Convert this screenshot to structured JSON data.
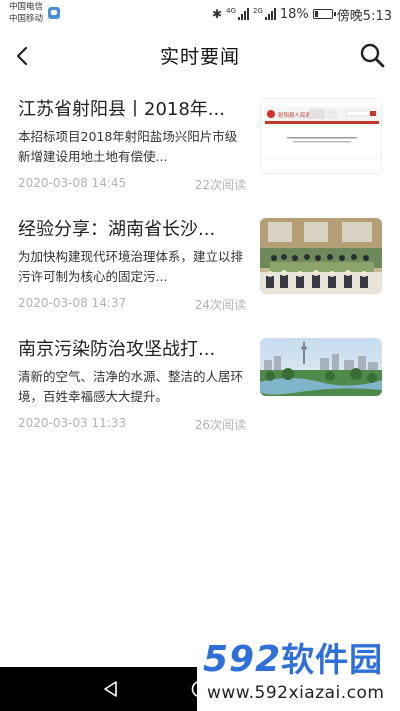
{
  "status_bar": {
    "carrier_1": "中国电信",
    "carrier_2": "中国移动",
    "net_1": "4G",
    "net_2": "2G",
    "battery_level": 0.18,
    "battery": "18%",
    "time": "傍晚5:13"
  },
  "header": {
    "title": "实时要闻"
  },
  "news": [
    {
      "title": "江苏省射阳县丨2018年...",
      "desc": "本招标项目2018年射阳盐场兴阳片市级新增建设用地土地有偿使...",
      "date": "2020-03-08 14:45",
      "reads": "22次阅读",
      "thumb_icon": "webpage-screenshot-thumbnail",
      "thumb_text": "射阳县人民政府"
    },
    {
      "title": "经验分享：湖南省长沙...",
      "desc": "为加快构建现代环境治理体系，建立以排污许可制为核心的固定污...",
      "date": "2020-03-08 14:37",
      "reads": "24次阅读",
      "thumb_icon": "conference-room-photo"
    },
    {
      "title": "南京污染防治攻坚战打...",
      "desc": "清新的空气、洁净的水源、整洁的人居环境，百姓幸福感大大提升。",
      "date": "2020-03-03 11:33",
      "reads": "26次阅读",
      "thumb_icon": "city-skyline-photo"
    }
  ],
  "watermark": {
    "logo_num": "592",
    "logo_cn": "软件园",
    "url": "www.592xiazai.com"
  },
  "colors": {
    "meta_text": "#b3b3b3",
    "watermark_blue": "#2e6fd8",
    "nav_bar": "#000000"
  }
}
